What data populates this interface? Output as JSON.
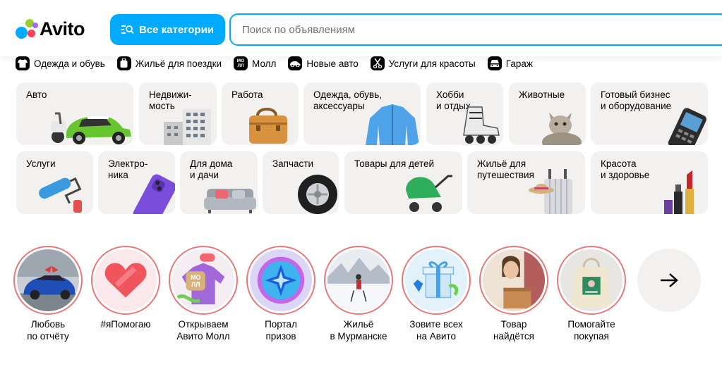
{
  "header": {
    "logo_text": "Avito",
    "categories_button": "Все категории",
    "search_placeholder": "Поиск по объявлениям"
  },
  "quick_links": [
    {
      "label": "Одежда и обувь",
      "icon": "tshirt-icon"
    },
    {
      "label": "Жильё для поездки",
      "icon": "suitcase-icon"
    },
    {
      "label": "Молл",
      "icon": "mall-logo-icon"
    },
    {
      "label": "Новые авто",
      "icon": "car-icon"
    },
    {
      "label": "Услуги для красоты",
      "icon": "scissors-icon"
    },
    {
      "label": "Гараж",
      "icon": "garage-car-icon"
    }
  ],
  "categories": [
    {
      "label": "Авто"
    },
    {
      "label": "Недвижи-\nмость"
    },
    {
      "label": "Работа"
    },
    {
      "label": "Одежда, обувь,\nаксессуары"
    },
    {
      "label": "Хобби\nи отдых"
    },
    {
      "label": "Животные"
    },
    {
      "label": "Готовый бизнес\nи оборудование"
    },
    {
      "label": "Услуги"
    },
    {
      "label": "Электро-\nника"
    },
    {
      "label": "Для дома\nи дачи"
    },
    {
      "label": "Запчасти"
    },
    {
      "label": "Товары для детей"
    },
    {
      "label": "Жильё для\nпутешествия"
    },
    {
      "label": "Красота\nи здоровье"
    }
  ],
  "stories": [
    {
      "label": "Любовь\nпо отчёту"
    },
    {
      "label": "#яПомогаю"
    },
    {
      "label": "Открываем\nАвито Молл",
      "badge": "МО\nЛЛ"
    },
    {
      "label": "Портал\nпризов"
    },
    {
      "label": "Жильё\nв Мурманске"
    },
    {
      "label": "Зовите всех\nна Авито"
    },
    {
      "label": "Товар\nнайдётся"
    },
    {
      "label": "Помогайте\nпокупая"
    }
  ],
  "colors": {
    "accent": "#00aaff",
    "tile_bg": "#f2f1f0",
    "story_ring": "#e8797a"
  }
}
